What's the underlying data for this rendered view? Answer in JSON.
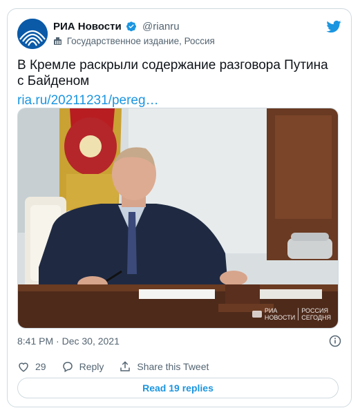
{
  "account": {
    "name": "РИА Новости",
    "handle": "@rianru",
    "label": "Государственное издание, Россия"
  },
  "tweet": {
    "text": "В Кремле раскрыли содержание разговора Путина с Байденом",
    "link": "ria.ru/20211231/pereg…",
    "timestamp": "8:41 PM · Dec 30, 2021"
  },
  "media": {
    "watermark_brand": "РИА\nНОВОСТИ",
    "watermark_sub": "РОССИЯ\nСЕГОДНЯ"
  },
  "actions": {
    "like_count": "29",
    "reply_label": "Reply",
    "share_label": "Share this Tweet"
  },
  "footer": {
    "read_replies_label": "Read 19 replies"
  },
  "icons": {
    "verified": "verified-badge-icon",
    "state_media": "state-media-icon",
    "brand": "twitter-bird-icon",
    "info": "info-icon",
    "like": "heart-icon",
    "reply": "reply-bubble-icon",
    "share": "share-upload-icon"
  },
  "colors": {
    "accent": "#1b95e0",
    "muted": "#536471",
    "border": "#cfd9de"
  }
}
